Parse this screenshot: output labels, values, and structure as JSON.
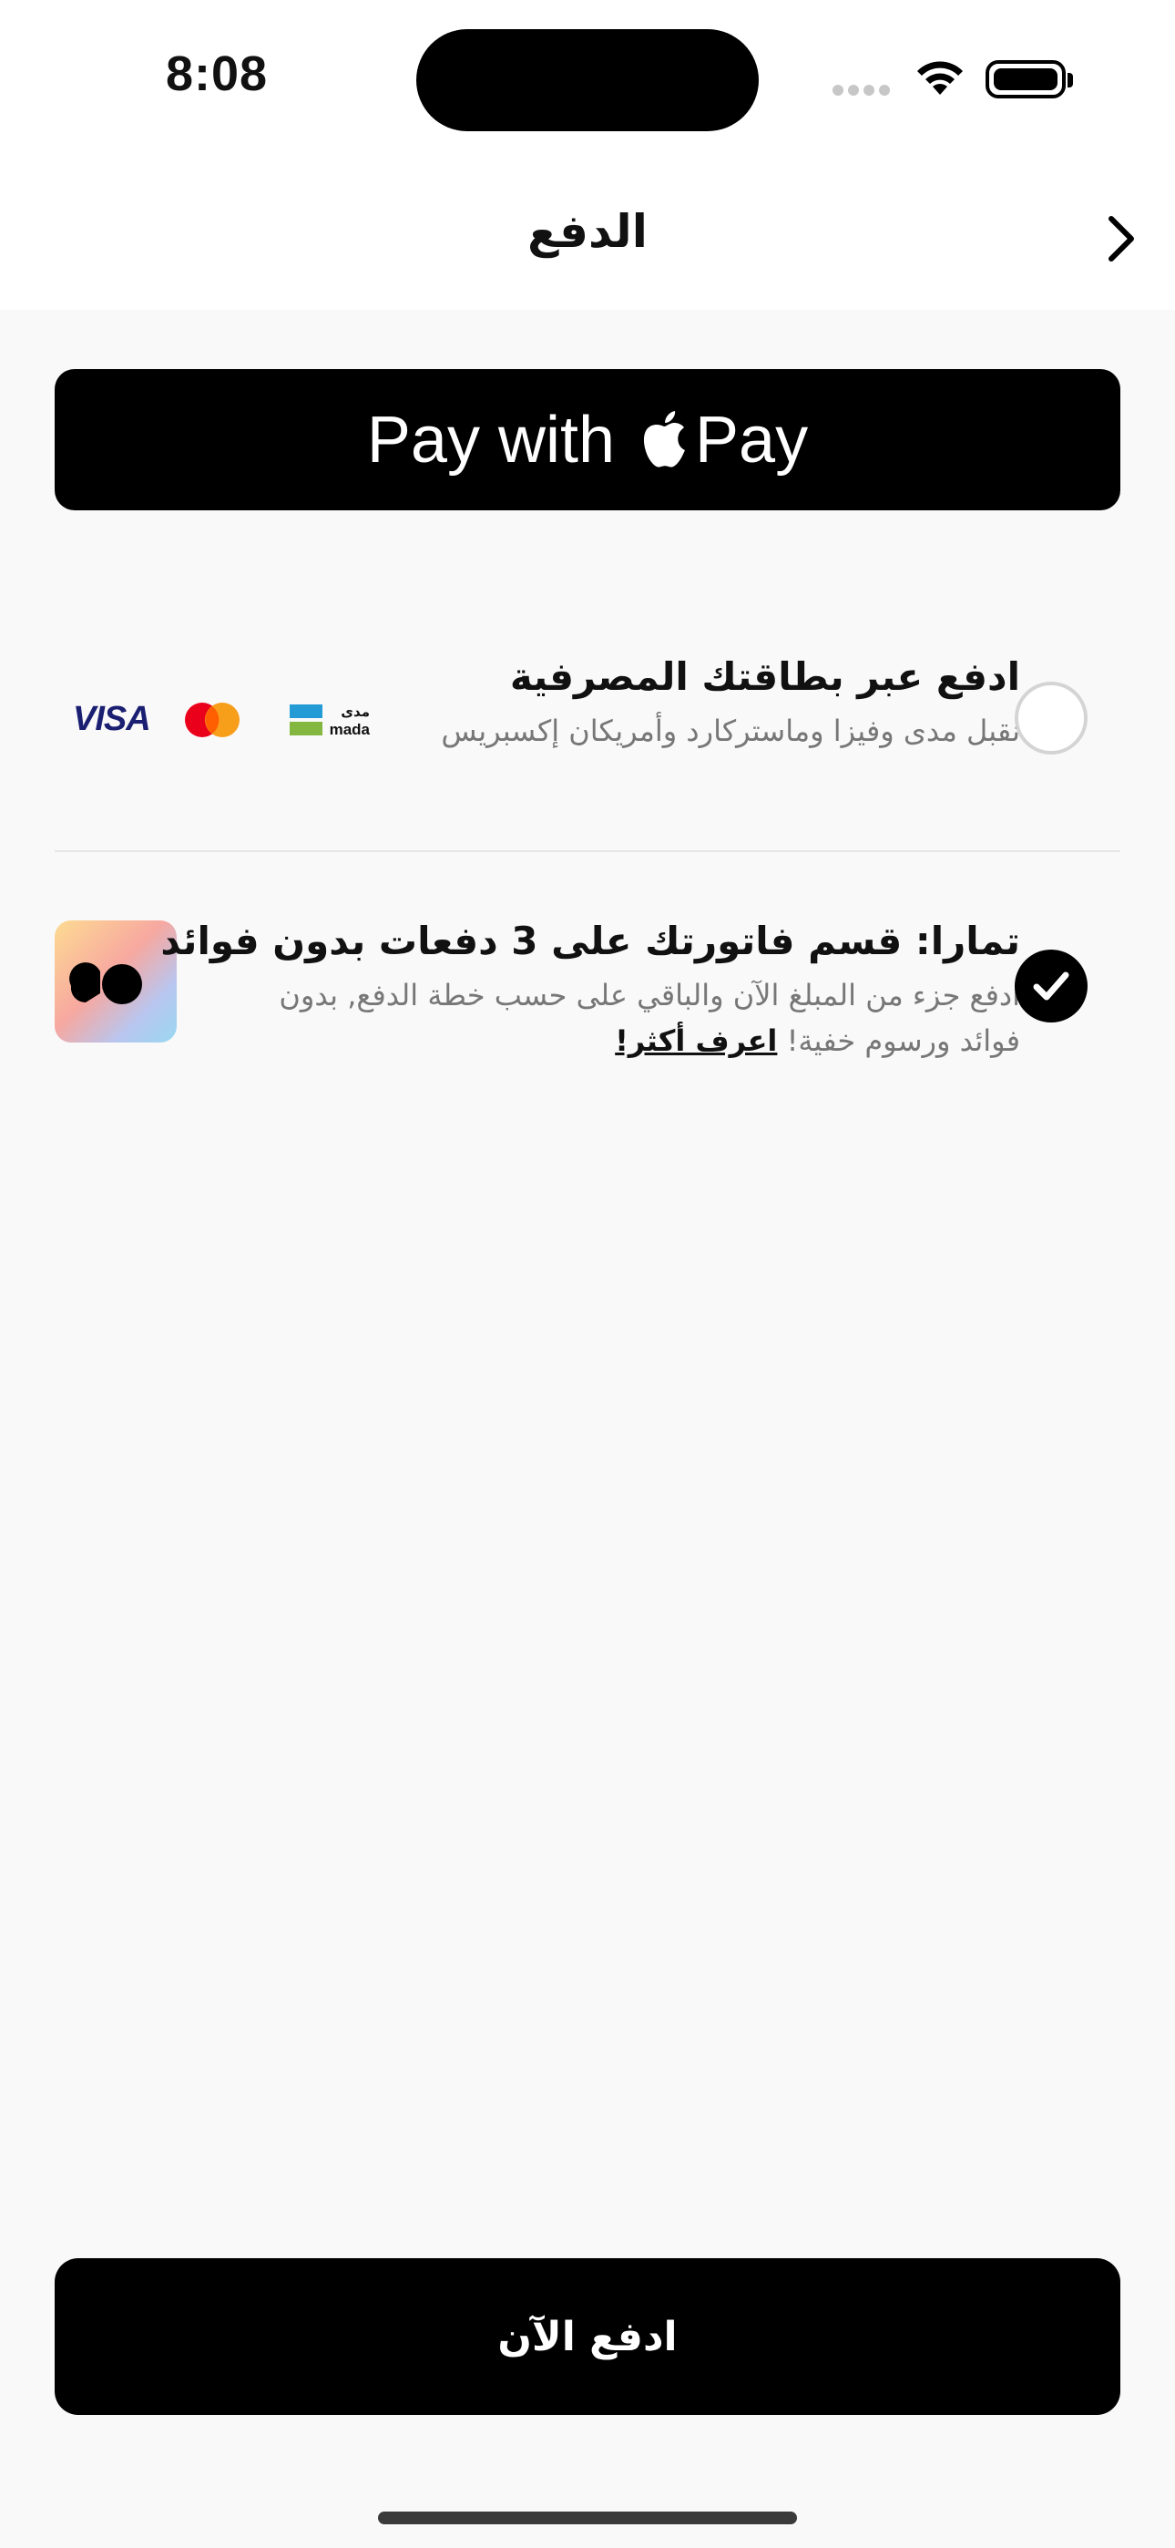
{
  "status_bar": {
    "time": "8:08",
    "icons": [
      "signal-icon",
      "wifi-icon",
      "battery-icon"
    ]
  },
  "nav": {
    "title": "الدفع",
    "back_icon": "chevron-right-icon"
  },
  "apple_pay": {
    "label_prefix": "Pay with",
    "label_suffix": "Pay",
    "icon": "apple-logo-icon"
  },
  "payment_options": [
    {
      "title": "ادفع عبر بطاقتك المصرفية",
      "subtitle": "نقبل مدى وفيزا وماستركارد وأمريكان إكسبريس",
      "selected": false,
      "logos": [
        "VISA",
        "MasterCard",
        "مدى",
        "mada"
      ]
    },
    {
      "title": "تمارا: قسم فاتورتك على 3 دفعات بدون فوائد",
      "subtitle": "ادفع جزء من المبلغ الآن والباقي على حسب خطة الدفع, بدون فوائد ورسوم خفية!",
      "link": "اعرف أكثر!",
      "selected": true,
      "logo": "tamara-logo-icon"
    }
  ],
  "footer": {
    "pay_now_label": "ادفع الآن"
  },
  "colors": {
    "background": "#f9f9f9",
    "primary_button": "#000000",
    "primary_text": "#111111",
    "secondary_text": "#777777",
    "visa_blue": "#1a1f71",
    "mastercard_red": "#eb001b",
    "mastercard_orange": "#f79e1b",
    "mada_blue": "#259bd6",
    "mada_green": "#84b740"
  }
}
